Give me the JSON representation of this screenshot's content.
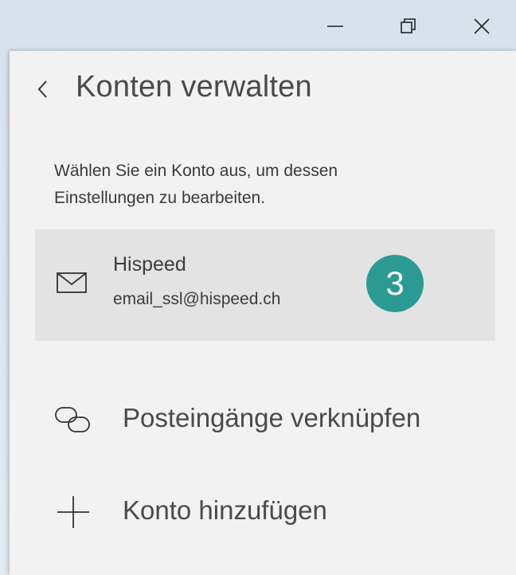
{
  "window_controls": {
    "minimize_icon": "minimize-icon",
    "restore_icon": "restore-icon",
    "close_icon": "close-icon"
  },
  "panel": {
    "title": "Konten verwalten",
    "back_icon": "chevron-left-icon",
    "instruction": "Wählen Sie ein Konto aus, um dessen Einstellungen zu bearbeiten.",
    "accounts": [
      {
        "icon": "mail-icon",
        "name": "Hispeed",
        "email": "email_ssl@hispeed.ch",
        "badge": "3"
      }
    ],
    "actions": [
      {
        "icon": "link-icon",
        "label": "Posteingänge verknüpfen"
      },
      {
        "icon": "plus-icon",
        "label": "Konto hinzufügen"
      }
    ]
  },
  "colors": {
    "badge": "#2b9a93",
    "panel_bg": "#f2f2f2",
    "selected_item_bg": "#e3e3e3"
  }
}
